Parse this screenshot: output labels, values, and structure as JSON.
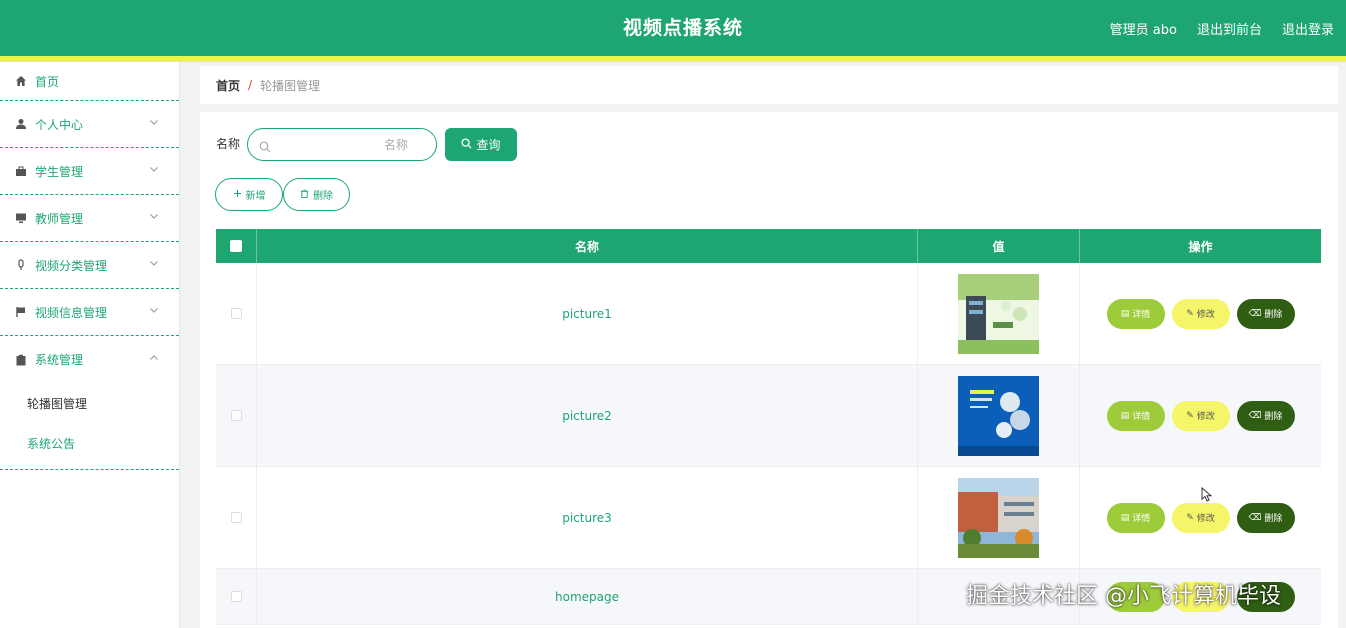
{
  "header": {
    "title": "视频点播系统",
    "user": "管理员 abo",
    "to_front": "退出到前台",
    "logout": "退出登录",
    "bg_color": "#1ea672",
    "stripe_color": "#eef25a"
  },
  "sidebar": {
    "items": [
      {
        "label": "首页",
        "icon": "home-icon"
      },
      {
        "label": "个人中心",
        "icon": "user-icon"
      },
      {
        "label": "学生管理",
        "icon": "briefcase-icon"
      },
      {
        "label": "教师管理",
        "icon": "monitor-icon"
      },
      {
        "label": "视频分类管理",
        "icon": "mic-icon"
      },
      {
        "label": "视频信息管理",
        "icon": "flag-icon"
      },
      {
        "label": "系统管理",
        "icon": "clipboard-icon"
      }
    ],
    "submenu": [
      "轮播图管理",
      "系统公告"
    ]
  },
  "breadcrumb": {
    "home": "首页",
    "separator": "/",
    "current": "轮播图管理"
  },
  "search": {
    "label": "名称",
    "placeholder": "名称",
    "button": "查询"
  },
  "actions": {
    "add": "新增",
    "delete": "删除"
  },
  "table": {
    "headers": [
      "名称",
      "值",
      "操作"
    ],
    "rows": [
      {
        "name": "picture1"
      },
      {
        "name": "picture2"
      },
      {
        "name": "picture3"
      },
      {
        "name": "homepage"
      }
    ],
    "row_buttons": {
      "detail": "详情",
      "edit": "修改",
      "delete": "删除"
    }
  },
  "watermark": "掘金技术社区 @小飞计算机毕设"
}
